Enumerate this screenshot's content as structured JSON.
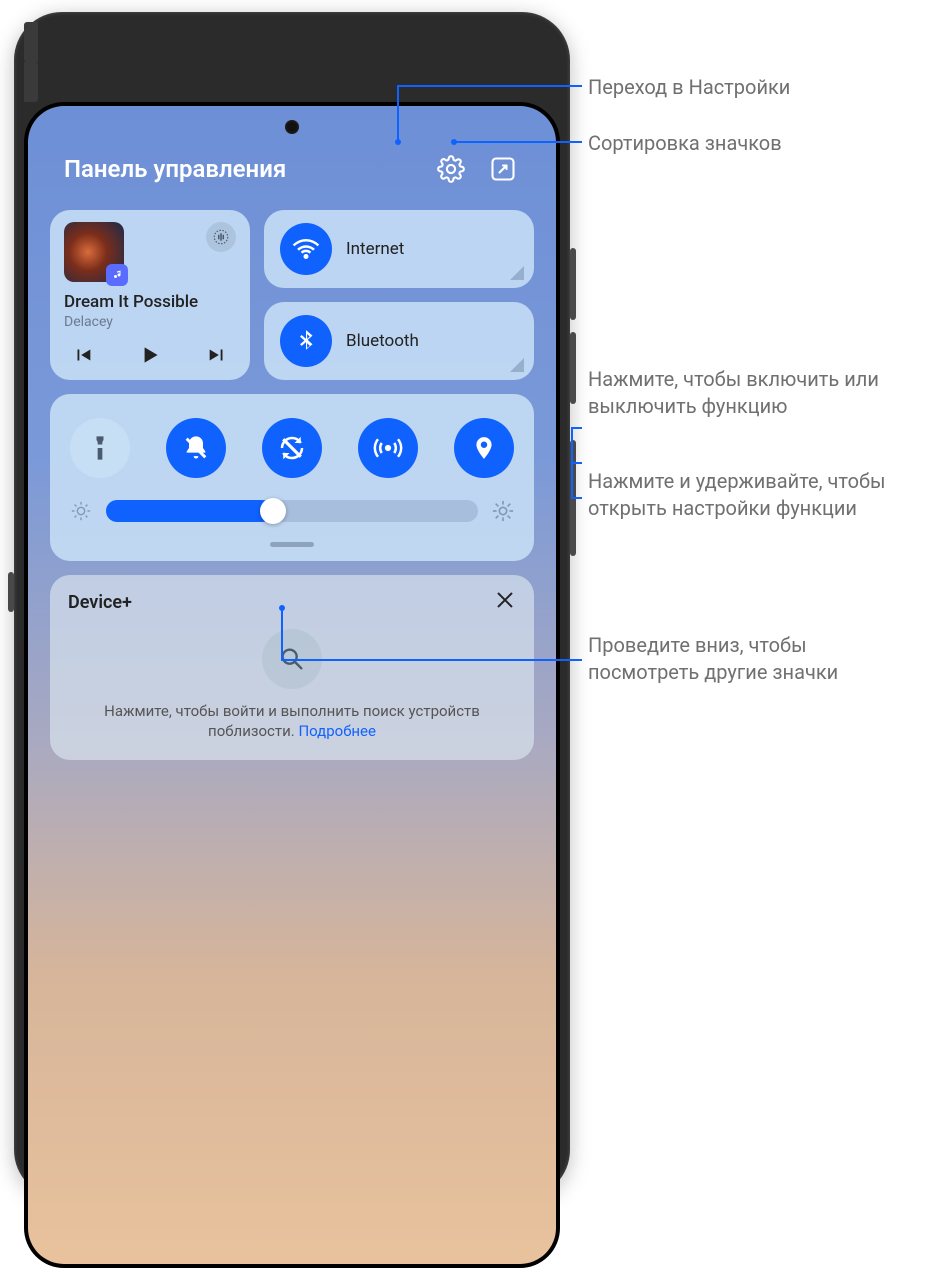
{
  "header": {
    "title": "Панель управления"
  },
  "music": {
    "title": "Dream It Possible",
    "artist": "Delacey"
  },
  "toggles": {
    "wifi": "Internet",
    "bluetooth": "Bluetooth"
  },
  "brightness": {
    "percent": 45
  },
  "device": {
    "title": "Device+",
    "hint_pre": "Нажмите, чтобы войти и выполнить поиск устройств поблизости. ",
    "hint_link": "Подробнее"
  },
  "annotations": {
    "settings": "Переход в Настройки",
    "sort": "Сортировка значков",
    "tap": "Нажмите, чтобы включить или выключить функцию",
    "hold": "Нажмите и удерживайте, чтобы открыть настройки функции",
    "swipe": "Проведите вниз, чтобы посмотреть другие значки"
  }
}
